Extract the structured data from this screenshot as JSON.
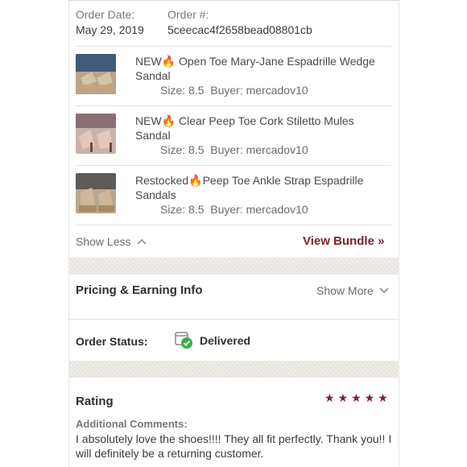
{
  "order": {
    "date_label": "Order Date:",
    "date_value": "May 29, 2019",
    "number_label": "Order #:",
    "number_value": "5ceecac4f2658bead08801cb"
  },
  "items": [
    {
      "prefix": "NEW",
      "title_rest": " Open Toe Mary-Jane Espadrille Wedge",
      "title_line2": "Sandal",
      "size": "Size: 8.5",
      "buyer": "Buyer: mercadov10"
    },
    {
      "prefix": "NEW",
      "title_rest": " Clear Peep Toe Cork Stiletto Mules",
      "title_line2": "Sandal",
      "size": "Size: 8.5",
      "buyer": "Buyer: mercadov10"
    },
    {
      "prefix": "Restocked",
      "title_rest": "Peep Toe Ankle Strap Espadrille",
      "title_line2": "Sandals",
      "size": "Size: 8.5",
      "buyer": "Buyer: mercadov10"
    }
  ],
  "bundle": {
    "show_less": "Show Less",
    "view_bundle": "View Bundle »"
  },
  "pricing": {
    "title": "Pricing & Earning Info",
    "show_more": "Show More"
  },
  "status": {
    "label": "Order Status:",
    "value": "Delivered"
  },
  "rating": {
    "title": "Rating",
    "stars": 5,
    "comments_label": "Additional Comments:",
    "comment_line1": "I absolutely love the shoes!!!! They all fit perfectly. Thank you!! I",
    "comment_line2": "will definitely be a returning customer."
  },
  "colors": {
    "accent": "#7b2230",
    "success": "#2fb24c"
  },
  "icons": {
    "fire": "fire-icon",
    "chevron_up": "chevron-up-icon",
    "chevron_down": "chevron-down-icon",
    "star": "star-icon",
    "delivered": "package-check-icon"
  }
}
